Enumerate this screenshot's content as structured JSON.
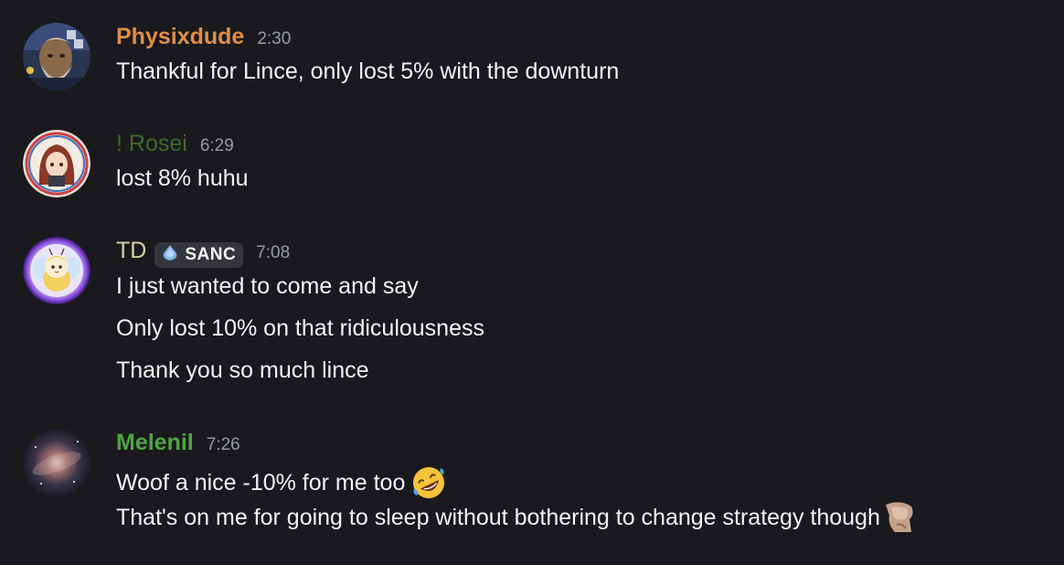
{
  "colors": {
    "background": "#1a1a1e",
    "timestamp": "#949ba4",
    "message_text": "#f2f3f5"
  },
  "messages": [
    {
      "username": "Physixdude",
      "username_color": "#e08e45",
      "timestamp": "2:30",
      "avatar_icon": "bearded-man-avatar",
      "lines": [
        "Thankful for Lince, only lost 5% with the downturn"
      ]
    },
    {
      "username": "! Rosei",
      "username_color": "#3f6a2a",
      "timestamp": "6:29",
      "avatar_icon": "anime-girl-avatar",
      "lines": [
        "lost 8% huhu"
      ]
    },
    {
      "username": "TD",
      "username_color": "#d6d2a6",
      "timestamp": "7:08",
      "avatar_icon": "bee-character-avatar",
      "badge": {
        "label": "SANC",
        "icon": "droplet-icon"
      },
      "lines": [
        "I just wanted to come and say",
        "Only lost 10% on that ridiculousness",
        "Thank you so much lince"
      ]
    },
    {
      "username": "Melenil",
      "username_color": "#4fa544",
      "timestamp": "7:26",
      "avatar_icon": "galaxy-avatar",
      "lines": [
        "Woof a nice -10% for me too",
        "That's on me for going to sleep without bothering to change strategy though"
      ],
      "emojis": [
        "rofl-emoji-icon",
        "custom-emoji-icon"
      ]
    }
  ]
}
